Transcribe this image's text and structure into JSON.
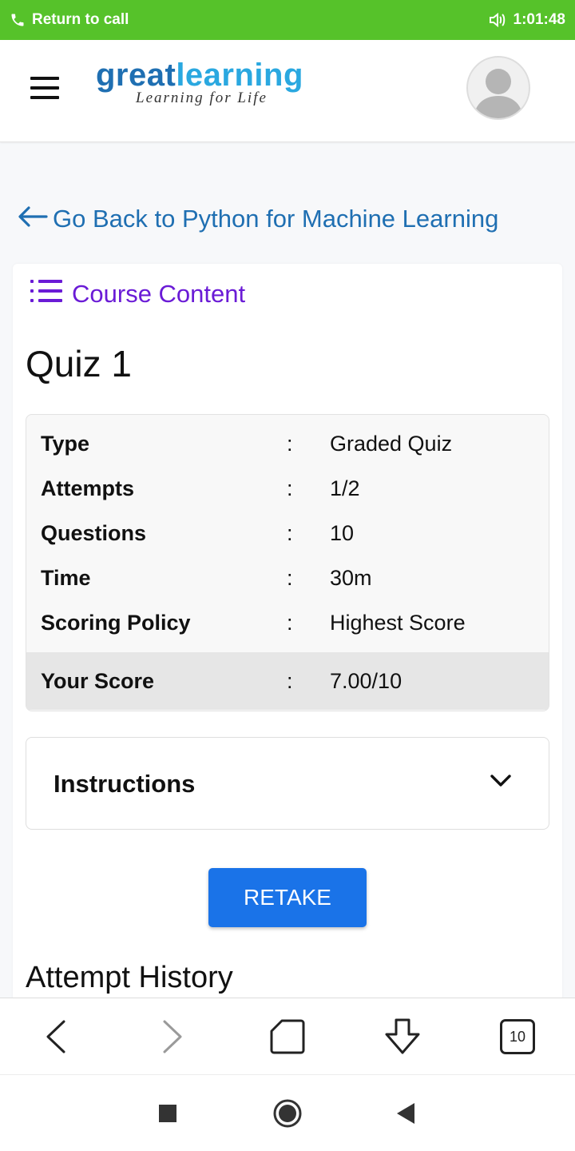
{
  "status_bar": {
    "call_text": "Return to call",
    "time": "1:01:48",
    "color": "#56c22a"
  },
  "header": {
    "logo_great": "great",
    "logo_learning": "learning",
    "logo_tagline": "Learning for Life"
  },
  "back_link": {
    "label": "Go Back to Python for Machine Learning"
  },
  "course_content": {
    "label": "Course Content"
  },
  "quiz": {
    "title": "Quiz 1",
    "details": [
      {
        "label": "Type",
        "sep": ":",
        "value": "Graded Quiz"
      },
      {
        "label": "Attempts",
        "sep": ":",
        "value": "1/2"
      },
      {
        "label": "Questions",
        "sep": ":",
        "value": "10"
      },
      {
        "label": "Time",
        "sep": ":",
        "value": "30m"
      },
      {
        "label": "Scoring Policy",
        "sep": ":",
        "value": "Highest Score"
      }
    ],
    "score": {
      "label": "Your Score",
      "sep": ":",
      "value": "7.00/10"
    }
  },
  "instructions": {
    "label": "Instructions"
  },
  "retake_button": {
    "label": "RETAKE",
    "color": "#1a73e8"
  },
  "attempt_history": {
    "title": "Attempt History"
  },
  "browser_nav": {
    "tab_count": "10"
  },
  "colors": {
    "link_blue": "#1f6fb2",
    "course_purple": "#6a1bd6"
  }
}
